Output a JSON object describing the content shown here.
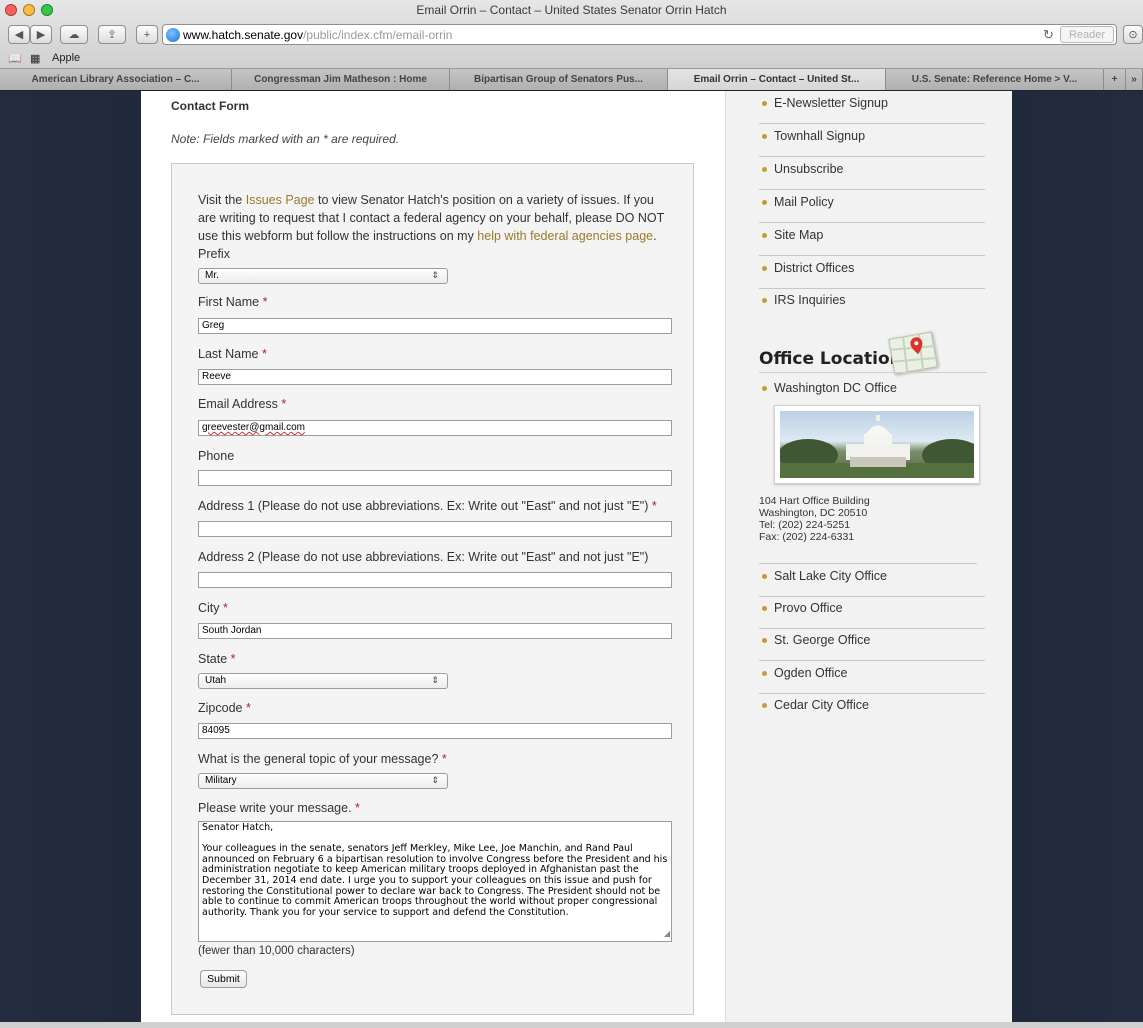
{
  "window": {
    "title": "Email Orrin – Contact – United States Senator Orrin Hatch",
    "url_host": "www.hatch.senate.gov",
    "url_path": "/public/index.cfm/email-orrin",
    "reader_label": "Reader",
    "bookmark_label": "Apple"
  },
  "tabs": [
    {
      "label": "American Library Association – C..."
    },
    {
      "label": "Congressman Jim Matheson : Home"
    },
    {
      "label": "Bipartisan Group of Senators Pus..."
    },
    {
      "label": "Email Orrin – Contact – United St..."
    },
    {
      "label": "U.S. Senate: Reference Home > V..."
    }
  ],
  "form": {
    "heading": "Contact Form",
    "note": "Note: Fields marked with an * are required.",
    "intro": {
      "t1": "Visit the ",
      "issues_link": "Issues Page",
      "t2": " to view Senator Hatch's position on a variety of issues. If you are writing to request that I contact a federal agency on your behalf, please DO NOT use this webform but follow the instructions on my ",
      "agencies_link": "help with federal agencies page",
      "t3": "."
    },
    "required_mark": "*",
    "prefix": {
      "label": "Prefix",
      "value": "Mr."
    },
    "first_name": {
      "label": "First Name",
      "value": "Greg"
    },
    "last_name": {
      "label": "Last Name",
      "value": "Reeve"
    },
    "email": {
      "label": "Email Address",
      "value": "greevester@gmail.com"
    },
    "phone": {
      "label": "Phone",
      "value": ""
    },
    "address1": {
      "label": "Address 1 (Please do not use abbreviations. Ex: Write out \"East\" and not just \"E\")",
      "value": ""
    },
    "address2": {
      "label": "Address 2 (Please do not use abbreviations. Ex: Write out \"East\" and not just \"E\")",
      "value": ""
    },
    "city": {
      "label": "City",
      "value": "South Jordan"
    },
    "state": {
      "label": "State",
      "value": "Utah"
    },
    "zipcode": {
      "label": "Zipcode",
      "value": "84095"
    },
    "topic": {
      "label": "What is the general topic of your message?",
      "value": "Military"
    },
    "message": {
      "label": "Please write your message.",
      "value": "Senator Hatch,\n\nYour colleagues in the senate, senators Jeff Merkley, Mike Lee, Joe Manchin, and Rand Paul\nannounced on February 6 a bipartisan resolution to involve Congress before the President and his\nadministration negotiate to keep American military troops deployed in Afghanistan past the\nDecember 31, 2014 end date. I urge you to support your colleagues on this issue and push for\nrestoring the Constitutional power to declare war back to Congress. The President should not be\nable to continue to commit American troops throughout the world without proper congressional\nauthority. Thank you for your service to support and defend the Constitution."
    },
    "char_note": "(fewer than 10,000 characters)",
    "submit_label": "Submit"
  },
  "sidebar": {
    "links": [
      {
        "label": "E-Newsletter Signup"
      },
      {
        "label": "Townhall Signup"
      },
      {
        "label": "Unsubscribe"
      },
      {
        "label": "Mail Policy"
      },
      {
        "label": "Site Map"
      },
      {
        "label": "District Offices"
      },
      {
        "label": "IRS Inquiries"
      }
    ],
    "office_heading": "Office Locations",
    "dc_office": {
      "label": "Washington DC Office",
      "address1": "104 Hart Office Building",
      "address2": "Washington, DC 20510",
      "tel": "Tel: (202) 224-5251",
      "fax": "Fax: (202) 224-6331"
    },
    "offices": [
      {
        "label": "Salt Lake City Office"
      },
      {
        "label": "Provo Office"
      },
      {
        "label": "St. George Office"
      },
      {
        "label": "Ogden Office"
      },
      {
        "label": "Cedar City Office"
      }
    ]
  },
  "colors": {
    "link": "#9b7a2c",
    "required": "#b22222",
    "bullet": "#c79a34",
    "page_background": "#1c2433"
  }
}
